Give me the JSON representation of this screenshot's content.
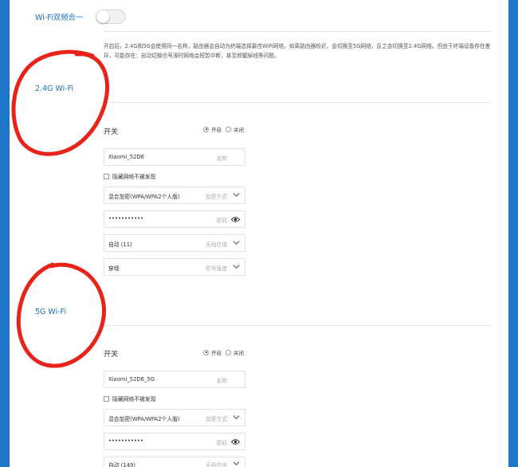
{
  "dual_band": {
    "label": "Wi-Fi双频合一",
    "enabled": false
  },
  "description": "开启后，2.4G和5G会使用同一名称，路由器会自动为终端选择最佳WiFi网络，如离路由器较近，会切换至5G网络，反之会切换至2.4G网络。但由于终端设备存在差异，可能存在：自动切换信号源时网络会短暂中断，甚至频繁掉线等问题。",
  "sections": [
    {
      "title": "2.4G Wi-Fi",
      "switch_label": "开关",
      "radio_on": "开启",
      "radio_off": "关闭",
      "selected": "开启",
      "ssid_value": "Xiaomi_52D6",
      "ssid_hint": "名称",
      "hide_label": "隐藏网络不被发现",
      "encryption_value": "混合加密(WPA/WPA2个人版)",
      "encryption_hint": "加密方式",
      "password_value": "•••••••••••",
      "password_hint": "密码",
      "channel_value": "自动 (11)",
      "channel_hint": "无线信道",
      "strength_value": "穿墙",
      "strength_hint": "信号强度"
    },
    {
      "title": "5G Wi-Fi",
      "switch_label": "开关",
      "radio_on": "开启",
      "radio_off": "关闭",
      "selected": "开启",
      "ssid_value": "Xiaomi_52D6_5G",
      "ssid_hint": "名称",
      "hide_label": "隐藏网络不被发现",
      "encryption_value": "混合加密(WPA/WPA2个人版)",
      "encryption_hint": "加密方式",
      "password_value": "•••••••••••",
      "password_hint": "密码",
      "channel_value": "自动 (149)",
      "channel_hint": "无线信道"
    }
  ],
  "colors": {
    "accent": "#1a6fc1",
    "frame": "#1f77c9",
    "annotation": "#e8231a"
  },
  "icons": [
    "chevron-down-icon",
    "eye-icon",
    "radio-icon",
    "checkbox-icon"
  ]
}
